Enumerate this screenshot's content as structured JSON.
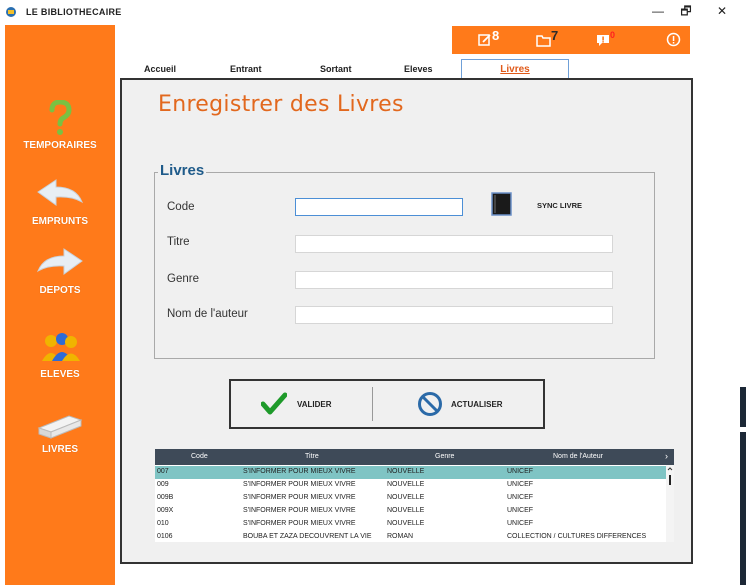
{
  "window": {
    "title": "LE  BIBLIOTHECAIRE",
    "minimize": "—",
    "maximize": "🗗",
    "close": "✕"
  },
  "sidebar": {
    "items": [
      {
        "label": "TEMPORAIRES",
        "icon": "question-icon"
      },
      {
        "label": "EMPRUNTS",
        "icon": "arrow-left-icon"
      },
      {
        "label": "DEPOTS",
        "icon": "arrow-right-icon"
      },
      {
        "label": "ELEVES",
        "icon": "users-icon"
      },
      {
        "label": "LIVRES",
        "icon": "book-icon"
      }
    ]
  },
  "topbar": {
    "edit_count": "8",
    "folder_count": "7",
    "alert_count": "0"
  },
  "tabs": [
    "Accueil",
    "Entrant",
    "Sortant",
    "Eleves",
    "Livres"
  ],
  "page": {
    "title": "Enregistrer des Livres",
    "legend": "Livres",
    "fields": {
      "code": "Code",
      "titre": "Titre",
      "genre": "Genre",
      "auteur": "Nom de l'auteur"
    },
    "sync_label": "SYNC LIVRE",
    "valider": "VALIDER",
    "actualiser": "ACTUALISER"
  },
  "grid": {
    "columns": [
      "Code",
      "Titre",
      "Genre",
      "Nom de l'Auteur"
    ],
    "rows": [
      [
        "007",
        "S'INFORMER POUR MIEUX VIVRE",
        "NOUVELLE",
        "UNICEF"
      ],
      [
        "009",
        "S'INFORMER POUR MIEUX VIVRE",
        "NOUVELLE",
        "UNICEF"
      ],
      [
        "009B",
        "S'INFORMER POUR MIEUX VIVRE",
        "NOUVELLE",
        "UNICEF"
      ],
      [
        "009X",
        "S'INFORMER POUR MIEUX VIVRE",
        "NOUVELLE",
        "UNICEF"
      ],
      [
        "010",
        "S'INFORMER POUR MIEUX VIVRE",
        "NOUVELLE",
        "UNICEF"
      ],
      [
        "0106",
        "BOUBA ET ZAZA DECOUVRENT LA VIE",
        "ROMAN",
        "COLLECTION / CULTURES DIFFERENCES"
      ]
    ]
  },
  "colors": {
    "accent": "#ff7a1a",
    "title": "#e2681e",
    "legend": "#1f5b8a",
    "grid_header": "#3e4a58",
    "selected_row": "#7fc4c4"
  }
}
